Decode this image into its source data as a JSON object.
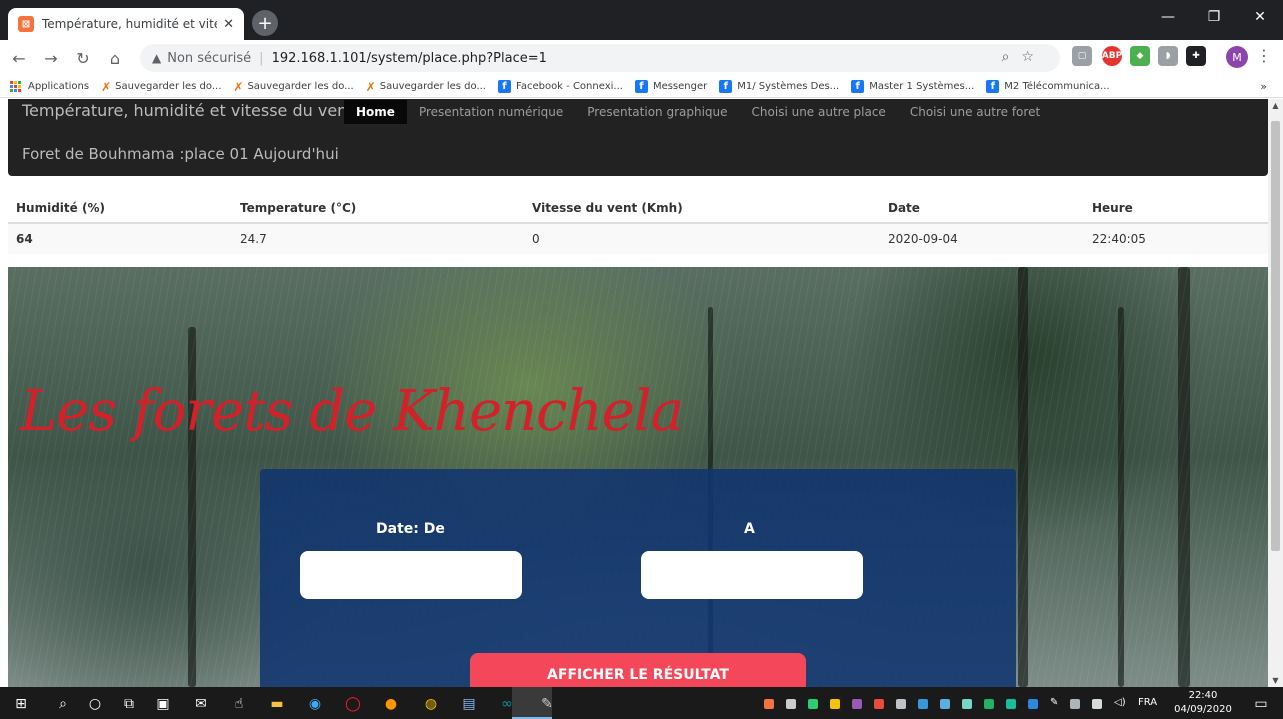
{
  "browser": {
    "tab_title": "Température, humidité et vitesse",
    "url_security": "Non sécurisé",
    "url": "192.168.1.101/system/place.php?Place=1",
    "avatar_letter": "M"
  },
  "bookmarks": [
    {
      "label": "Applications",
      "icon": "apps-grid-icon"
    },
    {
      "label": "Sauvegarder les do...",
      "icon": "bookmark-star-icon"
    },
    {
      "label": "Sauvegarder les do...",
      "icon": "bookmark-star-icon"
    },
    {
      "label": "Sauvegarder les do...",
      "icon": "bookmark-star-icon"
    },
    {
      "label": "Facebook - Connexi...",
      "icon": "facebook-icon"
    },
    {
      "label": "Messenger",
      "icon": "facebook-icon"
    },
    {
      "label": "M1/ Systèmes Des...",
      "icon": "facebook-icon"
    },
    {
      "label": "Master 1 Systèmes...",
      "icon": "facebook-icon"
    },
    {
      "label": "M2 Télécommunica...",
      "icon": "facebook-icon"
    }
  ],
  "site": {
    "brand": "Température, humidité et vitesse du vent",
    "nav": [
      "Home",
      "Presentation numérique",
      "Presentation graphique",
      "Choisi une autre place",
      "Choisi une autre foret"
    ],
    "active_nav": "Home",
    "subtitle": "Foret de Bouhmama :place 01 Aujourd'hui"
  },
  "table": {
    "headers": [
      "Humidité (%)",
      "Temperature (°C)",
      "Vitesse du vent (Kmh)",
      "Date",
      "Heure"
    ],
    "row": [
      "64",
      "24.7",
      "0",
      "2020-09-04",
      "22:40:05"
    ]
  },
  "hero": {
    "title": "Les forets de Khenchela",
    "date_from_label": "Date: De",
    "date_to_label": "A",
    "submit_label": "AFFICHER LE RÉSULTAT",
    "date_from_value": "",
    "date_to_value": ""
  },
  "taskbar": {
    "language": "FRA",
    "time": "22:40",
    "date": "04/09/2020"
  },
  "colors": {
    "nav_bg": "#222222",
    "hero_title": "#d32029",
    "panel": "#10346e",
    "submit": "#f4485a"
  }
}
